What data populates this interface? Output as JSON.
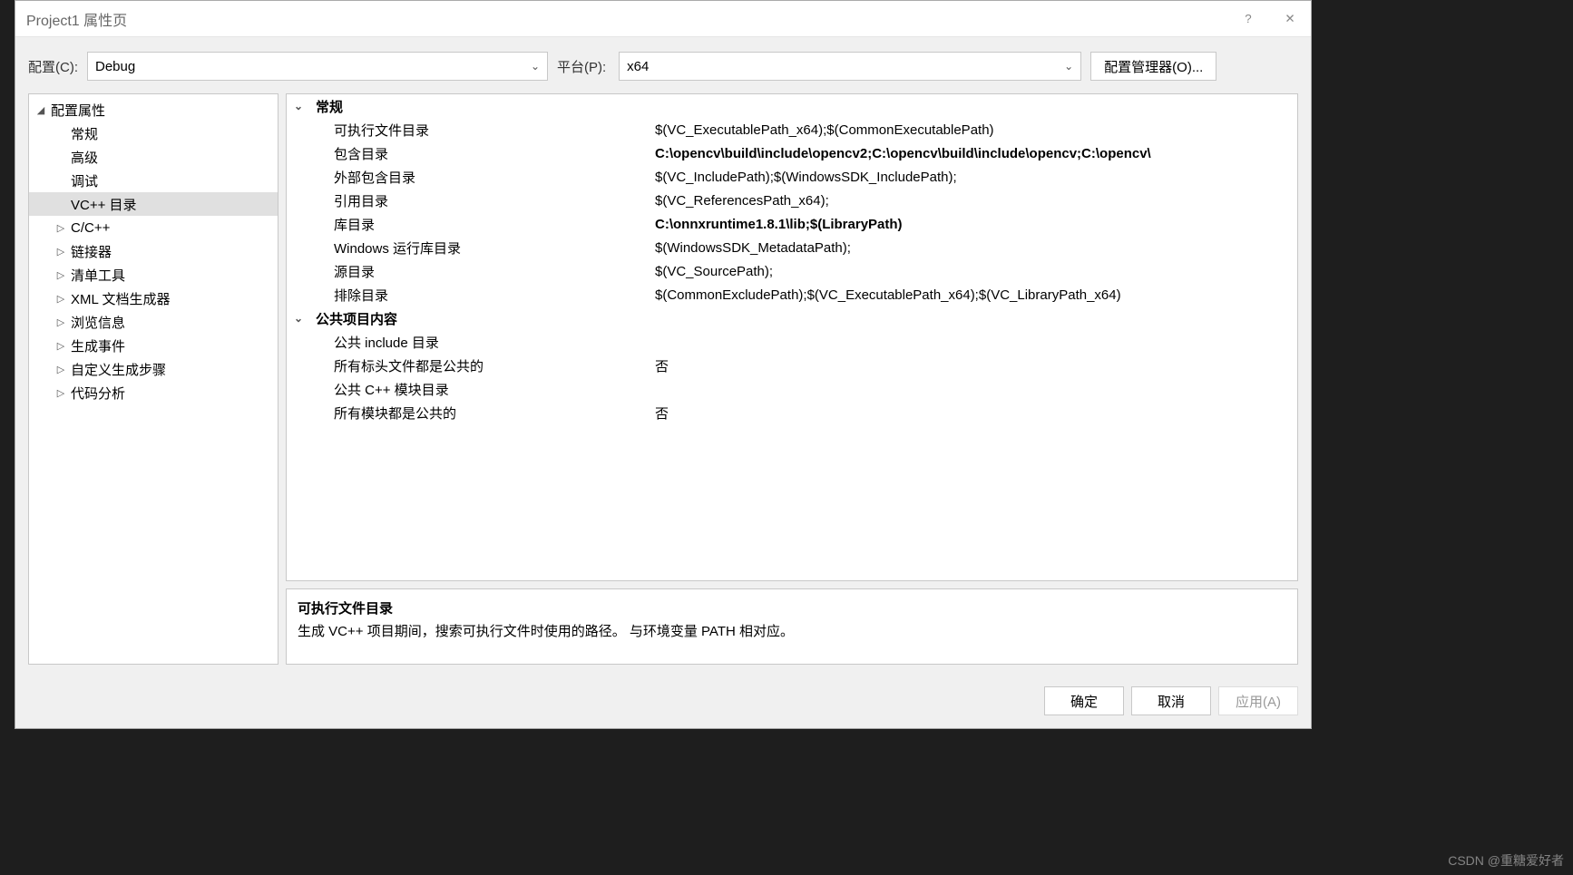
{
  "window": {
    "title": "Project1 属性页"
  },
  "toolbar": {
    "config_label": "配置(C):",
    "config_value": "Debug",
    "platform_label": "平台(P):",
    "platform_value": "x64",
    "config_manager_label": "配置管理器(O)..."
  },
  "tree": {
    "root": {
      "label": "配置属性",
      "expanded": true
    },
    "items": [
      {
        "label": "常规",
        "type": "leaf"
      },
      {
        "label": "高级",
        "type": "leaf"
      },
      {
        "label": "调试",
        "type": "leaf"
      },
      {
        "label": "VC++ 目录",
        "type": "leaf",
        "selected": true
      },
      {
        "label": "C/C++",
        "type": "expandable"
      },
      {
        "label": "链接器",
        "type": "expandable"
      },
      {
        "label": "清单工具",
        "type": "expandable"
      },
      {
        "label": "XML 文档生成器",
        "type": "expandable"
      },
      {
        "label": "浏览信息",
        "type": "expandable"
      },
      {
        "label": "生成事件",
        "type": "expandable"
      },
      {
        "label": "自定义生成步骤",
        "type": "expandable"
      },
      {
        "label": "代码分析",
        "type": "expandable"
      }
    ]
  },
  "props": {
    "sections": [
      {
        "title": "常规",
        "items": [
          {
            "name": "可执行文件目录",
            "value": "$(VC_ExecutablePath_x64);$(CommonExecutablePath)",
            "bold": false
          },
          {
            "name": "包含目录",
            "value": "C:\\opencv\\build\\include\\opencv2;C:\\opencv\\build\\include\\opencv;C:\\opencv\\",
            "bold": true
          },
          {
            "name": "外部包含目录",
            "value": "$(VC_IncludePath);$(WindowsSDK_IncludePath);",
            "bold": false
          },
          {
            "name": "引用目录",
            "value": "$(VC_ReferencesPath_x64);",
            "bold": false
          },
          {
            "name": "库目录",
            "value": "C:\\onnxruntime1.8.1\\lib;$(LibraryPath)",
            "bold": true
          },
          {
            "name": "Windows 运行库目录",
            "value": "$(WindowsSDK_MetadataPath);",
            "bold": false
          },
          {
            "name": "源目录",
            "value": "$(VC_SourcePath);",
            "bold": false
          },
          {
            "name": "排除目录",
            "value": "$(CommonExcludePath);$(VC_ExecutablePath_x64);$(VC_LibraryPath_x64)",
            "bold": false
          }
        ]
      },
      {
        "title": "公共项目内容",
        "items": [
          {
            "name": "公共 include 目录",
            "value": "",
            "bold": false
          },
          {
            "name": "所有标头文件都是公共的",
            "value": "否",
            "bold": false
          },
          {
            "name": "公共 C++ 模块目录",
            "value": "",
            "bold": false
          },
          {
            "name": "所有模块都是公共的",
            "value": "否",
            "bold": false
          }
        ]
      }
    ]
  },
  "description": {
    "title": "可执行文件目录",
    "text": "生成 VC++ 项目期间，搜索可执行文件时使用的路径。   与环境变量 PATH 相对应。"
  },
  "footer": {
    "ok": "确定",
    "cancel": "取消",
    "apply": "应用(A)"
  },
  "watermark": "CSDN @重糖爱好者"
}
